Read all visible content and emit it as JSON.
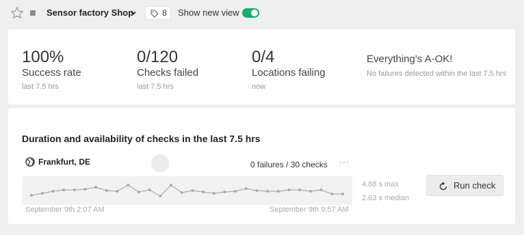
{
  "header": {
    "shop_name": "Sensor factory Shop",
    "tag_count": "8",
    "show_new_view": "Show new view",
    "toggle_on": true,
    "toggle_color": "#1dab6d"
  },
  "stats": [
    {
      "value": "100%",
      "label": "Success rate",
      "sub": "last 7.5 hrs"
    },
    {
      "value": "0/120",
      "label": "Checks failed",
      "sub": "last 7.5 hrs"
    },
    {
      "value": "0/4",
      "label": "Locations failing",
      "sub": "now"
    }
  ],
  "status": {
    "title": "Everything's A-OK!",
    "sub": "No failures detected within the last 7.5 hrs"
  },
  "checks": {
    "title": "Duration and availability of checks in the last 7.5 hrs",
    "location": "Frankfurt, DE",
    "failures": "0 failures / 30 checks",
    "more": "···",
    "start_time": "September 9th 2:07 AM",
    "end_time": "September 9th 9:57 AM",
    "max": "4.88 s max",
    "median": "2.63 s median",
    "run_label": "Run check"
  },
  "chart_data": {
    "type": "line",
    "x": [
      1,
      2,
      3,
      4,
      5,
      6,
      7,
      8,
      9,
      10,
      11,
      12,
      13,
      14,
      15,
      16,
      17,
      18,
      19,
      20,
      21,
      22,
      23,
      24,
      25,
      26,
      27,
      28,
      29,
      30
    ],
    "values": [
      2.5,
      2.8,
      3.1,
      3.3,
      3.3,
      3.4,
      3.7,
      3.2,
      3.1,
      4.0,
      3.0,
      3.3,
      2.4,
      4.0,
      2.9,
      3.2,
      3.0,
      2.8,
      3.0,
      3.1,
      3.5,
      3.2,
      3.1,
      3.1,
      3.3,
      3.3,
      3.1,
      3.3,
      2.7,
      2.7
    ],
    "ylim": [
      1.5,
      4.9
    ],
    "series_color": "#aaaaaa"
  }
}
